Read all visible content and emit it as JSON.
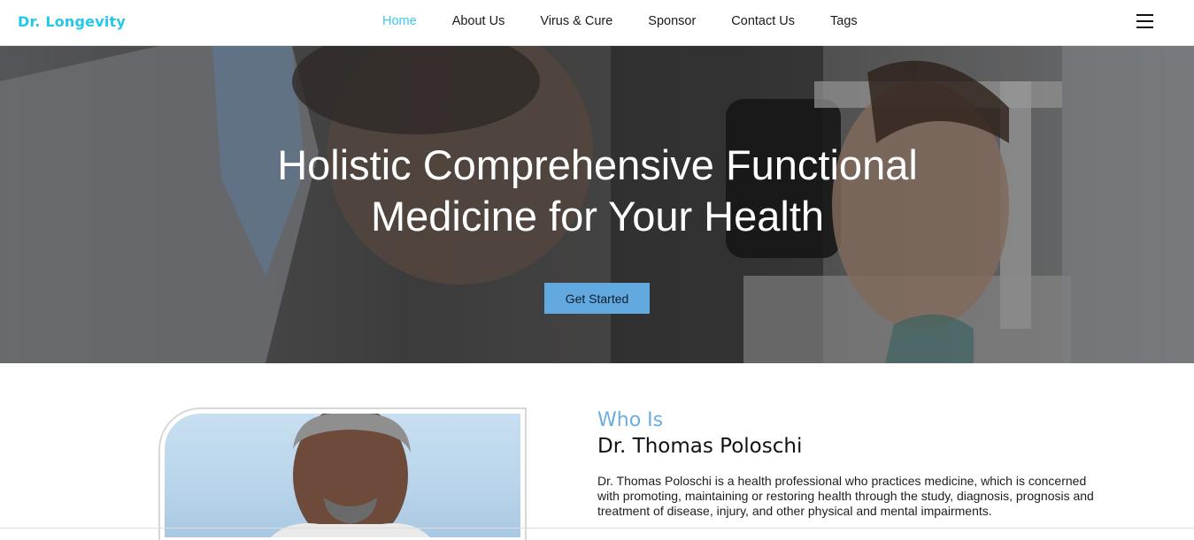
{
  "header": {
    "logo": "Dr. Longevity",
    "nav": [
      {
        "label": "Home",
        "active": true
      },
      {
        "label": "About Us",
        "active": false
      },
      {
        "label": "Virus & Cure",
        "active": false
      },
      {
        "label": "Sponsor",
        "active": false
      },
      {
        "label": "Contact Us",
        "active": false
      },
      {
        "label": "Tags",
        "active": false
      }
    ],
    "menu_icon": "hamburger-icon"
  },
  "hero": {
    "title_line1": "Holistic Comprehensive Functional",
    "title_line2": "Medicine for Your Health",
    "cta_label": "Get Started"
  },
  "about": {
    "kicker": "Who Is",
    "name": "Dr. Thomas Poloschi",
    "description": "Dr. Thomas Poloschi is a health professional who practices medicine, which is concerned with promoting, maintaining or restoring health through the study, diagnosis, prognosis and treatment of disease, injury, and other physical and mental impairments."
  },
  "colors": {
    "brand": "#22c8e8",
    "nav_active": "#3ec7ea",
    "cta": "#62a9e0",
    "kicker": "#6aaee0"
  }
}
